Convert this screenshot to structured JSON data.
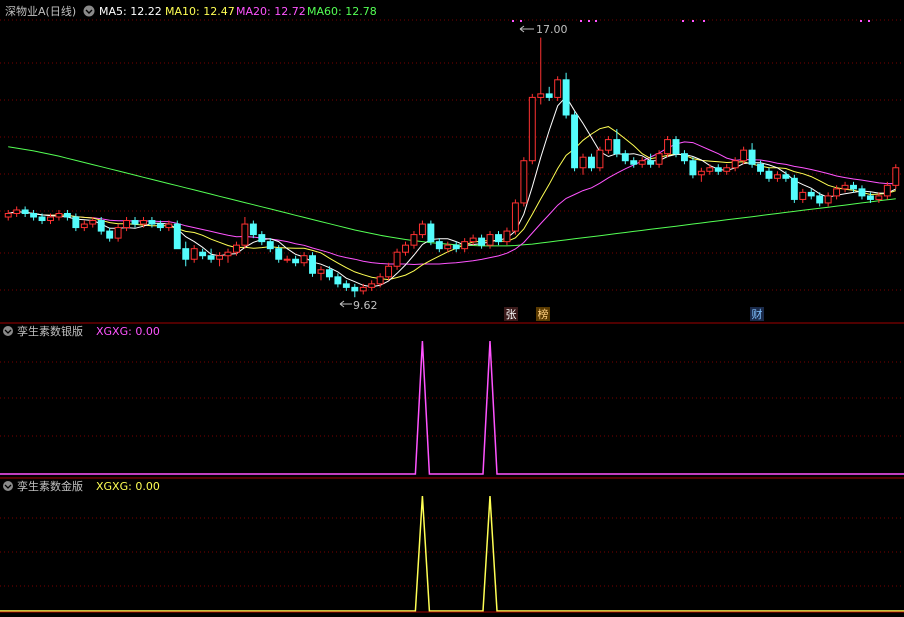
{
  "colors": {
    "up": "#ff3232",
    "down": "#54fcfc",
    "ma5": "#ffffff",
    "ma10": "#ffff54",
    "ma20": "#ff54ff",
    "ma60": "#54ff54",
    "grid": "#7a0000",
    "separator": "#a00000",
    "label": "#c0c0c0",
    "silver_signal": "#ff54ff",
    "gold_signal": "#ffff54",
    "marker": "#ff54ff"
  },
  "header": {
    "title": "深物业A(日线)",
    "ma5_label": "MA5: 12.22",
    "ma10_label": "MA10: 12.47",
    "ma20_label": "MA20: 12.72",
    "ma60_label": "MA60: 12.78",
    "icon": "chevron-down-icon"
  },
  "annotations": {
    "high": "17.00",
    "low": "9.62",
    "tag_zhang": "张",
    "tag_bang": "榜",
    "tag_cai": "财"
  },
  "silver_panel": {
    "title": "孪生素数银版",
    "value_label": "XGXG: 0.00",
    "icon": "chevron-down-icon"
  },
  "gold_panel": {
    "title": "孪生素数金版",
    "value_label": "XGXG: 0.00",
    "icon": "chevron-down-icon"
  },
  "chart_data": [
    {
      "type": "candlestick",
      "title": "深物业A(日线)",
      "ylim": [
        9.2,
        17.5
      ],
      "candles": [
        [
          11.9,
          12.1,
          11.8,
          12.0
        ],
        [
          12.0,
          12.2,
          11.9,
          12.1
        ],
        [
          12.1,
          12.2,
          11.9,
          12.0
        ],
        [
          12.0,
          12.1,
          11.8,
          11.9
        ],
        [
          11.9,
          12.0,
          11.7,
          11.8
        ],
        [
          11.8,
          12.0,
          11.7,
          11.9
        ],
        [
          11.9,
          12.1,
          11.8,
          12.0
        ],
        [
          12.0,
          12.1,
          11.8,
          11.9
        ],
        [
          11.9,
          12.0,
          11.5,
          11.6
        ],
        [
          11.6,
          11.8,
          11.5,
          11.7
        ],
        [
          11.7,
          11.9,
          11.6,
          11.8
        ],
        [
          11.8,
          11.9,
          11.4,
          11.5
        ],
        [
          11.5,
          11.6,
          11.2,
          11.3
        ],
        [
          11.3,
          11.7,
          11.2,
          11.6
        ],
        [
          11.6,
          11.9,
          11.5,
          11.8
        ],
        [
          11.8,
          11.9,
          11.6,
          11.7
        ],
        [
          11.7,
          11.9,
          11.6,
          11.8
        ],
        [
          11.8,
          11.9,
          11.6,
          11.7
        ],
        [
          11.7,
          11.8,
          11.5,
          11.6
        ],
        [
          11.6,
          11.8,
          11.5,
          11.7
        ],
        [
          11.7,
          11.8,
          11.2,
          11.0
        ],
        [
          11.0,
          11.2,
          10.5,
          10.7
        ],
        [
          10.7,
          11.1,
          10.6,
          11.0
        ],
        [
          10.9,
          11.0,
          10.7,
          10.8
        ],
        [
          10.8,
          11.0,
          10.6,
          10.7
        ],
        [
          10.7,
          10.9,
          10.5,
          10.8
        ],
        [
          10.8,
          11.0,
          10.6,
          10.9
        ],
        [
          10.9,
          11.2,
          10.8,
          11.1
        ],
        [
          11.1,
          11.9,
          11.0,
          11.7
        ],
        [
          11.7,
          11.8,
          11.3,
          11.4
        ],
        [
          11.4,
          11.5,
          11.1,
          11.2
        ],
        [
          11.2,
          11.3,
          10.9,
          11.0
        ],
        [
          11.0,
          11.1,
          10.6,
          10.7
        ],
        [
          10.7,
          10.8,
          10.6,
          10.7
        ],
        [
          10.7,
          10.8,
          10.5,
          10.6
        ],
        [
          10.6,
          10.9,
          10.5,
          10.8
        ],
        [
          10.8,
          10.9,
          10.2,
          10.3
        ],
        [
          10.3,
          10.5,
          10.1,
          10.4
        ],
        [
          10.4,
          10.5,
          10.1,
          10.2
        ],
        [
          10.2,
          10.3,
          9.9,
          10.0
        ],
        [
          10.0,
          10.1,
          9.8,
          9.9
        ],
        [
          9.9,
          10.0,
          9.62,
          9.8
        ],
        [
          9.8,
          10.0,
          9.7,
          9.9
        ],
        [
          9.9,
          10.1,
          9.8,
          10.0
        ],
        [
          10.0,
          10.3,
          9.9,
          10.2
        ],
        [
          10.2,
          10.6,
          10.1,
          10.5
        ],
        [
          10.5,
          11.0,
          10.4,
          10.9
        ],
        [
          10.9,
          11.2,
          10.8,
          11.1
        ],
        [
          11.1,
          11.5,
          11.0,
          11.4
        ],
        [
          11.4,
          11.8,
          11.3,
          11.7
        ],
        [
          11.7,
          11.8,
          11.1,
          11.2
        ],
        [
          11.2,
          11.3,
          10.9,
          11.0
        ],
        [
          11.0,
          11.2,
          10.9,
          11.1
        ],
        [
          11.1,
          11.2,
          10.9,
          11.0
        ],
        [
          11.0,
          11.3,
          10.9,
          11.2
        ],
        [
          11.2,
          11.4,
          11.1,
          11.3
        ],
        [
          11.3,
          11.4,
          11.0,
          11.1
        ],
        [
          11.1,
          11.5,
          11.0,
          11.4
        ],
        [
          11.4,
          11.5,
          11.1,
          11.2
        ],
        [
          11.2,
          11.6,
          11.1,
          11.5
        ],
        [
          11.5,
          12.4,
          11.4,
          12.3
        ],
        [
          12.3,
          13.6,
          12.2,
          13.5
        ],
        [
          13.5,
          15.4,
          13.4,
          15.3
        ],
        [
          15.3,
          17.0,
          15.1,
          15.4
        ],
        [
          15.4,
          15.6,
          15.2,
          15.3
        ],
        [
          15.3,
          15.9,
          15.2,
          15.8
        ],
        [
          15.8,
          16.0,
          14.7,
          14.8
        ],
        [
          14.8,
          14.9,
          13.2,
          13.3
        ],
        [
          13.3,
          13.7,
          13.1,
          13.6
        ],
        [
          13.6,
          13.7,
          13.2,
          13.3
        ],
        [
          13.3,
          13.9,
          13.2,
          13.8
        ],
        [
          13.8,
          14.2,
          13.7,
          14.1
        ],
        [
          14.1,
          14.4,
          13.6,
          13.7
        ],
        [
          13.7,
          13.8,
          13.4,
          13.5
        ],
        [
          13.5,
          13.6,
          13.3,
          13.4
        ],
        [
          13.4,
          13.6,
          13.3,
          13.5
        ],
        [
          13.5,
          13.7,
          13.3,
          13.4
        ],
        [
          13.4,
          13.8,
          13.3,
          13.7
        ],
        [
          13.7,
          14.2,
          13.6,
          14.1
        ],
        [
          14.1,
          14.2,
          13.6,
          13.7
        ],
        [
          13.7,
          13.8,
          13.4,
          13.5
        ],
        [
          13.5,
          13.6,
          13.0,
          13.1
        ],
        [
          13.1,
          13.3,
          12.9,
          13.2
        ],
        [
          13.2,
          13.4,
          13.1,
          13.3
        ],
        [
          13.3,
          13.4,
          13.1,
          13.2
        ],
        [
          13.2,
          13.4,
          13.1,
          13.3
        ],
        [
          13.3,
          13.6,
          13.2,
          13.5
        ],
        [
          13.5,
          13.9,
          13.4,
          13.8
        ],
        [
          13.8,
          14.0,
          13.3,
          13.4
        ],
        [
          13.4,
          13.5,
          13.1,
          13.2
        ],
        [
          13.2,
          13.3,
          12.9,
          13.0
        ],
        [
          13.0,
          13.2,
          12.9,
          13.1
        ],
        [
          13.1,
          13.2,
          12.9,
          13.0
        ],
        [
          13.0,
          13.1,
          12.3,
          12.4
        ],
        [
          12.4,
          12.7,
          12.3,
          12.6
        ],
        [
          12.6,
          12.7,
          12.4,
          12.5
        ],
        [
          12.5,
          12.6,
          12.2,
          12.3
        ],
        [
          12.3,
          12.6,
          12.2,
          12.5
        ],
        [
          12.5,
          12.8,
          12.4,
          12.7
        ],
        [
          12.7,
          12.9,
          12.6,
          12.8
        ],
        [
          12.8,
          12.9,
          12.6,
          12.7
        ],
        [
          12.7,
          12.8,
          12.4,
          12.5
        ],
        [
          12.5,
          12.6,
          12.3,
          12.4
        ],
        [
          12.4,
          12.6,
          12.3,
          12.5
        ],
        [
          12.5,
          12.9,
          12.4,
          12.8
        ],
        [
          12.8,
          13.4,
          12.7,
          13.3
        ]
      ],
      "ma_periods": [
        5,
        10,
        20,
        60
      ],
      "ma60_series": {
        "name": "MA60",
        "values": [
          13.9,
          13.86,
          13.82,
          13.78,
          13.73,
          13.68,
          13.63,
          13.57,
          13.51,
          13.45,
          13.39,
          13.33,
          13.27,
          13.21,
          13.15,
          13.09,
          13.03,
          12.97,
          12.91,
          12.85,
          12.79,
          12.73,
          12.67,
          12.61,
          12.55,
          12.49,
          12.43,
          12.37,
          12.31,
          12.25,
          12.19,
          12.13,
          12.07,
          12.01,
          11.95,
          11.89,
          11.83,
          11.77,
          11.71,
          11.65,
          11.59,
          11.53,
          11.48,
          11.43,
          11.38,
          11.34,
          11.3,
          11.26,
          11.23,
          11.2,
          11.17,
          11.15,
          11.13,
          11.11,
          11.1,
          11.09,
          11.08,
          11.08,
          11.08,
          11.08,
          11.09,
          11.11,
          11.13,
          11.16,
          11.19,
          11.22,
          11.25,
          11.28,
          11.31,
          11.34,
          11.37,
          11.4,
          11.43,
          11.46,
          11.49,
          11.52,
          11.55,
          11.58,
          11.61,
          11.64,
          11.67,
          11.7,
          11.73,
          11.76,
          11.79,
          11.82,
          11.85,
          11.88,
          11.91,
          11.94,
          11.97,
          12.0,
          12.03,
          12.06,
          12.09,
          12.12,
          12.15,
          12.18,
          12.21,
          12.24,
          12.27,
          12.3,
          12.33,
          12.36,
          12.39,
          12.42
        ]
      },
      "ma_labels": [
        "MA5: 12.22",
        "MA10: 12.47",
        "MA20: 12.72",
        "MA60: 12.78"
      ],
      "annotations": [
        "17.00",
        "9.62"
      ]
    },
    {
      "type": "line",
      "title": "孪生素数银版",
      "series": [
        {
          "name": "XGXG",
          "spikes_at": [
            49,
            57
          ]
        }
      ],
      "ylim": [
        0,
        1
      ]
    },
    {
      "type": "line",
      "title": "孪生素数金版",
      "series": [
        {
          "name": "XGXG",
          "spikes_at": [
            49,
            57
          ]
        }
      ],
      "ylim": [
        0,
        1
      ]
    }
  ]
}
